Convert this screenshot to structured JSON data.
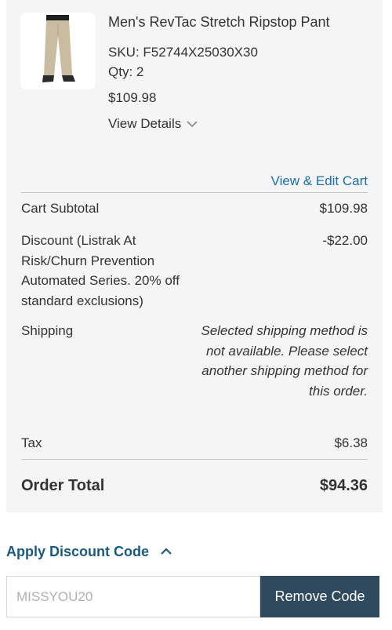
{
  "product": {
    "name": "Men's RevTac Stretch Ripstop Pant",
    "sku": "SKU: F52744X25030X30",
    "qty": "Qty: 2",
    "price": "$109.98",
    "view_details": "View Details",
    "image_icon": "pants-product-image"
  },
  "summary": {
    "edit_cart": "View & Edit Cart",
    "subtotal_label": "Cart Subtotal",
    "subtotal_value": "$109.98",
    "discount_label": "Discount (Listrak At Risk/Churn Prevention Automated Series. 20% off standard exclusions)",
    "discount_value": "-$22.00",
    "shipping_label": "Shipping",
    "shipping_value": "Selected shipping method is not available. Please select another shipping method for this order.",
    "tax_label": "Tax",
    "tax_value": "$6.38",
    "order_total_label": "Order Total",
    "order_total_value": "$94.36"
  },
  "discount": {
    "toggle_label": "Apply Discount Code",
    "code_value": "MISSYOU20",
    "remove_label": "Remove Code"
  },
  "colors": {
    "link": "#1a6fa8",
    "panel_bg": "#f5f5f5",
    "button_bg": "#2f4a5e"
  }
}
